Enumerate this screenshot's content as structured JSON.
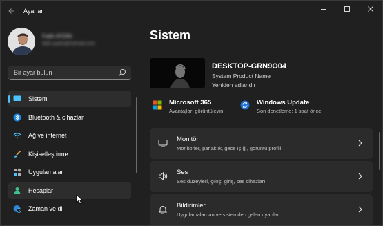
{
  "window": {
    "title": "Ayarlar",
    "controls": [
      "minimize",
      "maximize",
      "close"
    ]
  },
  "profile": {
    "name": "Fatih AYDIN",
    "email": "fatih.aydin@hotmail.com"
  },
  "search": {
    "placeholder": "Bir ayar bulun"
  },
  "sidebar": {
    "items": [
      {
        "label": "Sistem",
        "icon": "monitor-icon",
        "active": true
      },
      {
        "label": "Bluetooth & cihazlar",
        "icon": "bluetooth-icon"
      },
      {
        "label": "Ağ ve internet",
        "icon": "wifi-icon"
      },
      {
        "label": "Kişiselleştirme",
        "icon": "brush-icon"
      },
      {
        "label": "Uygulamalar",
        "icon": "apps-icon"
      },
      {
        "label": "Hesaplar",
        "icon": "person-icon",
        "hover": true
      },
      {
        "label": "Zaman ve dil",
        "icon": "globe-clock-icon"
      }
    ]
  },
  "main": {
    "title": "Sistem",
    "device": {
      "name": "DESKTOP-GRN9O04",
      "model": "System Product Name",
      "rename": "Yeniden adlandır"
    },
    "quick": [
      {
        "title": "Microsoft 365",
        "subtitle": "Avantajları görüntüleyin",
        "icon": "microsoft-logo-icon"
      },
      {
        "title": "Windows Update",
        "subtitle": "Son denetleme: 1 saat önce",
        "icon": "sync-icon"
      }
    ],
    "cards": [
      {
        "title": "Monitör",
        "subtitle": "Monitörler, parlaklık, gece ışığı, görüntü profili",
        "icon": "display-icon"
      },
      {
        "title": "Ses",
        "subtitle": "Ses düzeyleri, çıkış, giriş, ses cihazları",
        "icon": "speaker-icon"
      },
      {
        "title": "Bildirimler",
        "subtitle": "Uygulamalardan ve sistemden gelen uyarılar",
        "icon": "bell-icon"
      }
    ]
  },
  "colors": {
    "accent": "#4cc2ff",
    "background": "#202020",
    "card": "#2b2b2b"
  }
}
